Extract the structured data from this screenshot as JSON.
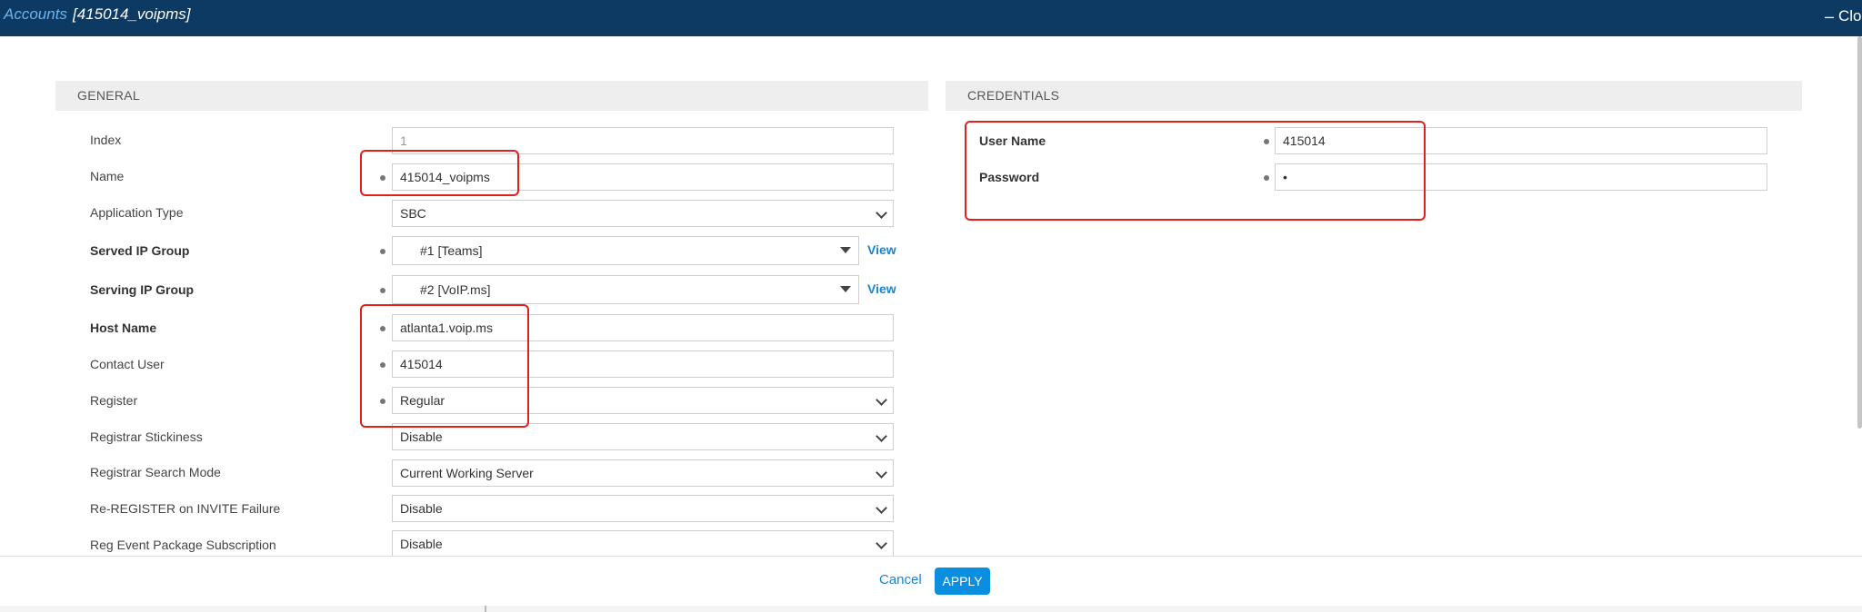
{
  "titlebar": {
    "crumb_link": "Accounts",
    "crumb_item": "[415014_voipms]",
    "minimize": "–",
    "close_label": "Close"
  },
  "general": {
    "title": "GENERAL",
    "index": {
      "label": "Index",
      "value": "1"
    },
    "name": {
      "label": "Name",
      "value": "415014_voipms"
    },
    "application_type": {
      "label": "Application Type",
      "value": "SBC"
    },
    "served_ip_group": {
      "label": "Served IP Group",
      "value": "#1 [Teams]",
      "view": "View"
    },
    "serving_ip_group": {
      "label": "Serving IP Group",
      "value": "#2 [VoIP.ms]",
      "view": "View"
    },
    "host_name": {
      "label": "Host Name",
      "value": "atlanta1.voip.ms"
    },
    "contact_user": {
      "label": "Contact User",
      "value": "415014"
    },
    "register": {
      "label": "Register",
      "value": "Regular"
    },
    "registrar_stickiness": {
      "label": "Registrar Stickiness",
      "value": "Disable"
    },
    "registrar_search_mode": {
      "label": "Registrar Search Mode",
      "value": "Current Working Server"
    },
    "reregister_on_invite_failure": {
      "label": "Re-REGISTER on INVITE Failure",
      "value": "Disable"
    },
    "reg_event_package_subscription": {
      "label": "Reg Event Package Subscription",
      "value": "Disable"
    }
  },
  "credentials": {
    "title": "CREDENTIALS",
    "user_name": {
      "label": "User Name",
      "value": "415014"
    },
    "password": {
      "label": "Password",
      "value": "•"
    }
  },
  "footer": {
    "cancel": "Cancel",
    "apply": "APPLY"
  },
  "colors": {
    "titlebar": "#0c3a63",
    "accent": "#1a84d1",
    "apply_button": "#0a8fe0",
    "highlight": "#e0201f"
  }
}
